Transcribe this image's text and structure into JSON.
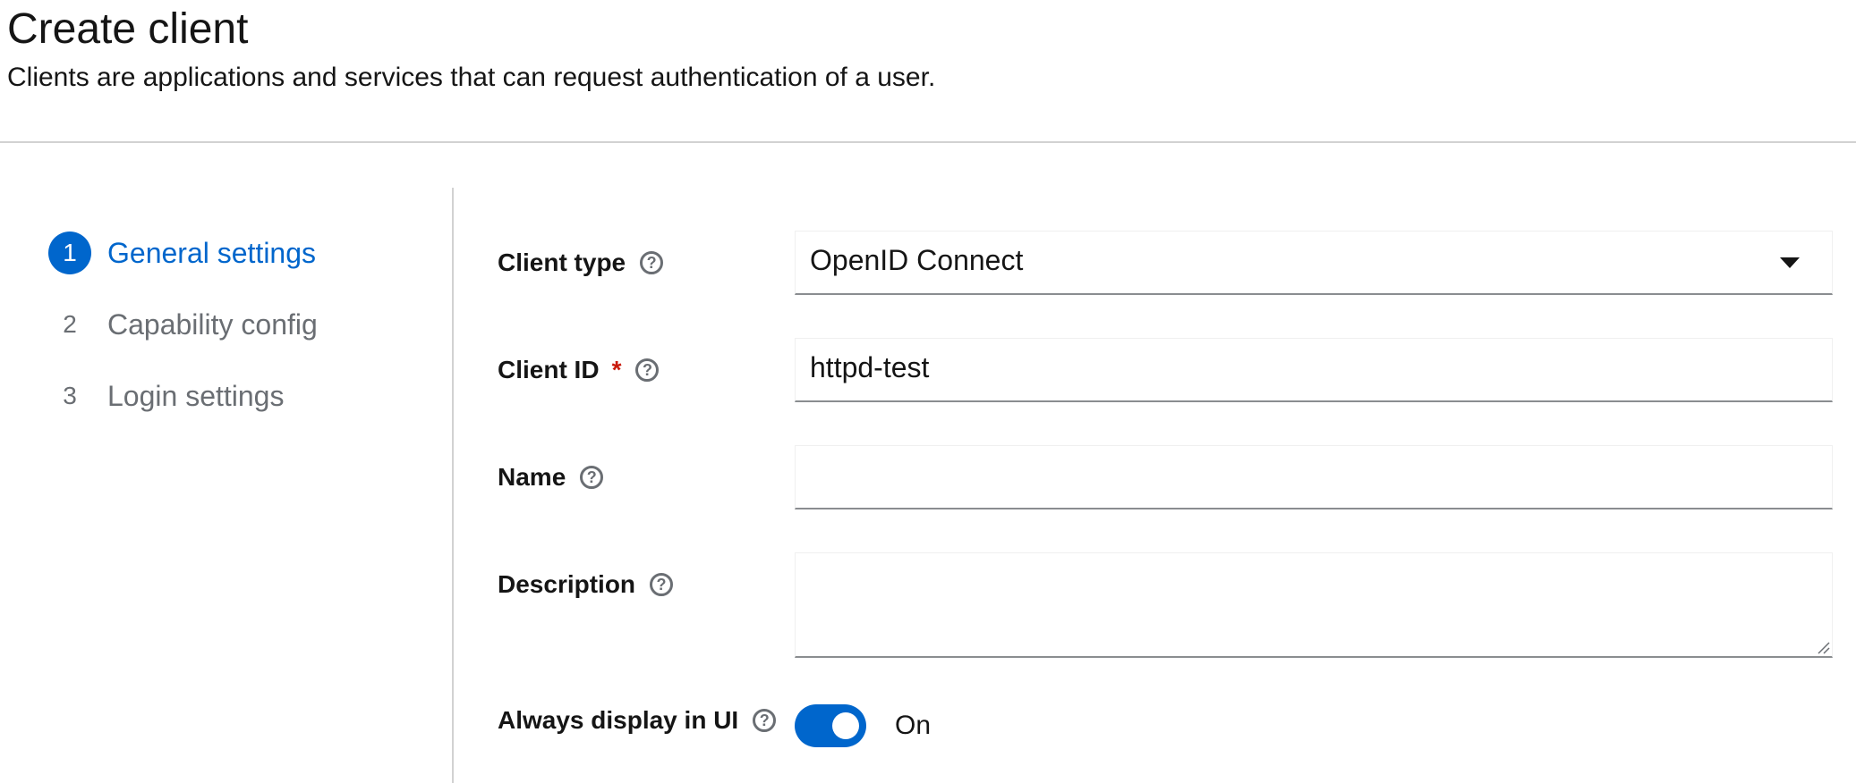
{
  "header": {
    "title": "Create client",
    "subtitle": "Clients are applications and services that can request authentication of a user."
  },
  "wizard": {
    "steps": [
      {
        "number": "1",
        "label": "General settings",
        "current": true
      },
      {
        "number": "2",
        "label": "Capability config",
        "current": false
      },
      {
        "number": "3",
        "label": "Login settings",
        "current": false
      }
    ]
  },
  "form": {
    "client_type": {
      "label": "Client type",
      "help_icon": "question-circle-icon",
      "value": "OpenID Connect",
      "options_visible": [
        "OpenID Connect"
      ]
    },
    "client_id": {
      "label": "Client ID",
      "required_marker": "*",
      "help_icon": "question-circle-icon",
      "value": "httpd-test"
    },
    "name": {
      "label": "Name",
      "help_icon": "question-circle-icon",
      "value": ""
    },
    "description": {
      "label": "Description",
      "help_icon": "question-circle-icon",
      "value": ""
    },
    "always_display": {
      "label": "Always display in UI",
      "help_icon": "question-circle-icon",
      "state_label": "On",
      "checked": true
    }
  },
  "colors": {
    "accent": "#0066cc",
    "required": "#c9190b",
    "muted": "#6a6e73",
    "border": "#d2d2d2"
  }
}
